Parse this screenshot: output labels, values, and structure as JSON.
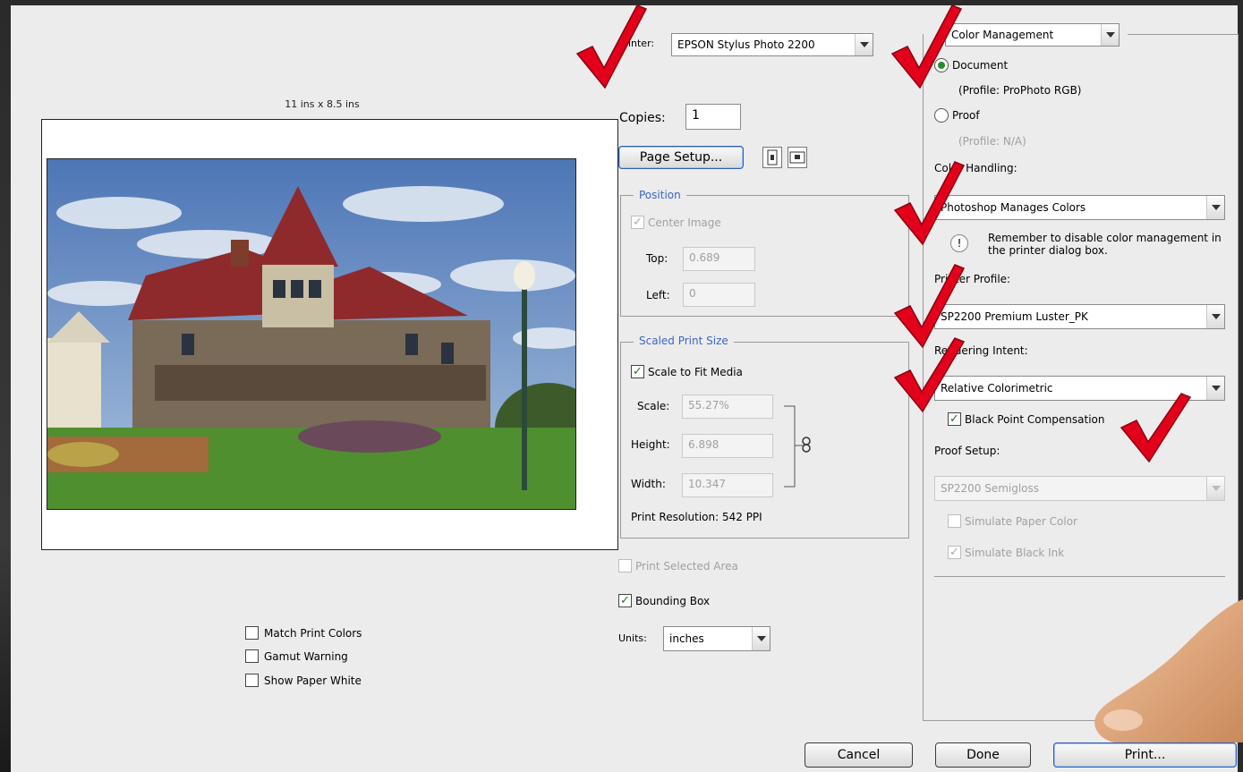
{
  "dialog": {
    "print_dimensions": "11 ins x 8.5 ins",
    "printer": {
      "label": "Printer:",
      "value": "EPSON Stylus Photo 2200"
    },
    "copies": {
      "label": "Copies:",
      "value": "1"
    },
    "page_setup_label": "Page Setup...",
    "position": {
      "title": "Position",
      "center_image_label": "Center Image",
      "top_label": "Top:",
      "top_value": "0.689",
      "left_label": "Left:",
      "left_value": "0"
    },
    "scaled_print_size": {
      "title": "Scaled Print Size",
      "scale_to_fit_label": "Scale to Fit Media",
      "scale_label": "Scale:",
      "scale_value": "55.27%",
      "height_label": "Height:",
      "height_value": "6.898",
      "width_label": "Width:",
      "width_value": "10.347",
      "resolution": "Print Resolution: 542 PPI"
    },
    "print_selected_area_label": "Print Selected Area",
    "bounding_box_label": "Bounding Box",
    "units": {
      "label": "Units:",
      "value": "inches"
    },
    "preview_options": [
      "Match Print Colors",
      "Gamut Warning",
      "Show Paper White"
    ],
    "color_management": {
      "section_select": "Color Management",
      "document_label": "Document",
      "document_profile": "(Profile: ProPhoto RGB)",
      "proof_label": "Proof",
      "proof_profile": "(Profile: N/A)",
      "color_handling_label": "Color Handling:",
      "color_handling_value": "Photoshop Manages Colors",
      "reminder": "Remember to disable color management in the printer dialog box.",
      "printer_profile_label": "Printer Profile:",
      "printer_profile_value": "SP2200 Premium Luster_PK",
      "rendering_intent_label": "Rendering Intent:",
      "rendering_intent_value": "Relative Colorimetric",
      "black_point_label": "Black Point Compensation",
      "proof_setup_label": "Proof Setup:",
      "proof_setup_value": "SP2200 Semigloss",
      "simulate_paper_label": "Simulate Paper Color",
      "simulate_ink_label": "Simulate Black Ink"
    },
    "buttons": {
      "cancel": "Cancel",
      "done": "Done",
      "print": "Print..."
    }
  },
  "colors": {
    "check_mark": "#e3001b",
    "group_title": "#3a66c4",
    "roof": "#8e2a2c"
  }
}
